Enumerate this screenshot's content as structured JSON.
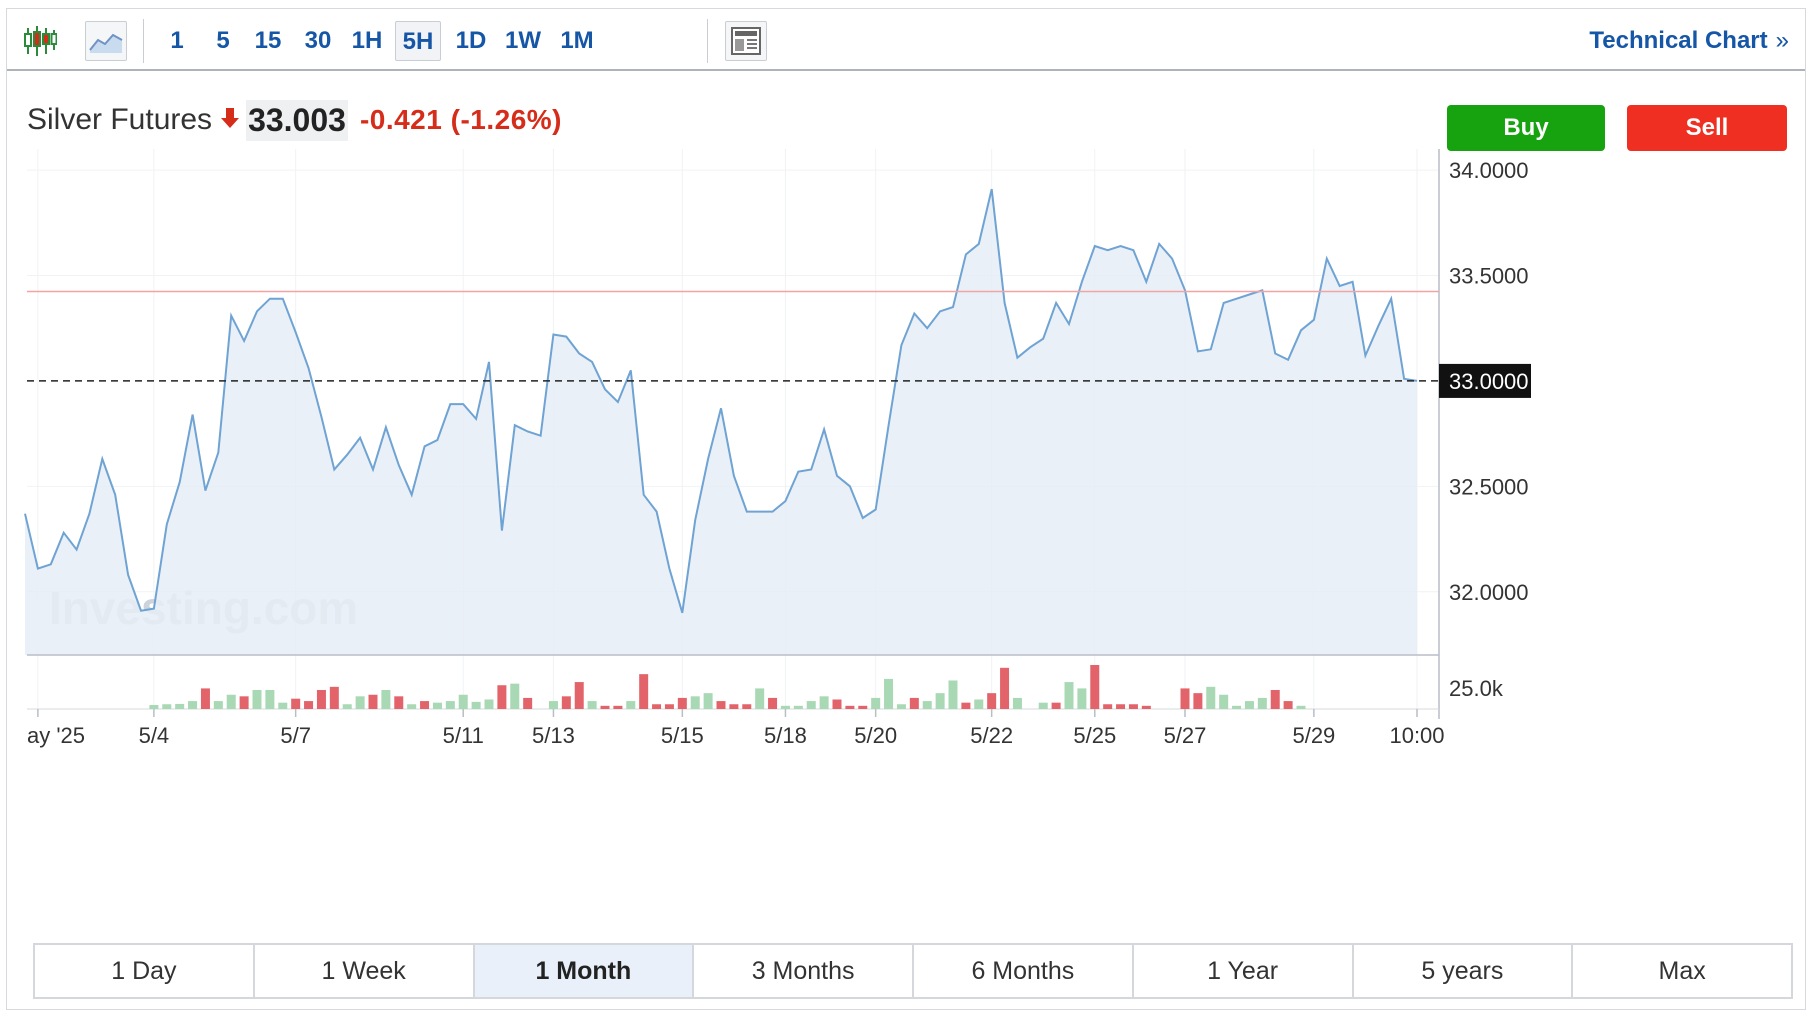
{
  "toolbar": {
    "candles_icon": "candlestick-icon",
    "area_icon": "area-chart-icon",
    "intervals": [
      {
        "label": "1",
        "active": false
      },
      {
        "label": "5",
        "active": false
      },
      {
        "label": "15",
        "active": false
      },
      {
        "label": "30",
        "active": false
      },
      {
        "label": "1H",
        "active": false
      },
      {
        "label": "5H",
        "active": true
      },
      {
        "label": "1D",
        "active": false
      },
      {
        "label": "1W",
        "active": false
      },
      {
        "label": "1M",
        "active": false
      }
    ],
    "layout_icon": "layout-icon",
    "technical_chart_label": "Technical Chart",
    "technical_chart_chevron": "»"
  },
  "quote": {
    "name": "Silver Futures",
    "direction": "down",
    "price": "33.003",
    "change": "-0.421",
    "change_pct": "(-1.26%)"
  },
  "actions": {
    "buy_label": "Buy",
    "sell_label": "Sell"
  },
  "colors": {
    "accent": "#1556a6",
    "buy": "#16a30f",
    "sell": "#ef2f22",
    "line": "#6fa3d3",
    "area": "#e6edf6",
    "prev_close_line": "#f2a3a3",
    "vol_up": "#a8d8b4",
    "vol_down": "#e2646a"
  },
  "chart_data": {
    "type": "area",
    "y_ticks": [
      "34.0000",
      "33.5000",
      "32.5000",
      "32.0000"
    ],
    "ylim": [
      31.7,
      34.1
    ],
    "current_price_label": "33.0000",
    "current_price_value": 33.0,
    "previous_close_value": 33.424,
    "watermark": "Investing.com",
    "x_tick_labels": [
      {
        "label": "ay '25",
        "i": 1
      },
      {
        "label": "5/4",
        "i": 10
      },
      {
        "label": "5/7",
        "i": 21
      },
      {
        "label": "5/11",
        "i": 34
      },
      {
        "label": "5/13",
        "i": 41
      },
      {
        "label": "5/15",
        "i": 51
      },
      {
        "label": "5/18",
        "i": 59
      },
      {
        "label": "5/20",
        "i": 66
      },
      {
        "label": "5/22",
        "i": 75
      },
      {
        "label": "5/25",
        "i": 83
      },
      {
        "label": "5/27",
        "i": 90
      },
      {
        "label": "5/29",
        "i": 100
      },
      {
        "label": "10:00",
        "i": 108
      }
    ],
    "prices": [
      32.37,
      32.11,
      32.13,
      32.28,
      32.2,
      32.37,
      32.63,
      32.46,
      32.08,
      31.91,
      31.92,
      32.32,
      32.52,
      32.84,
      32.48,
      32.66,
      33.31,
      33.19,
      33.33,
      33.39,
      33.39,
      33.23,
      33.06,
      32.83,
      32.58,
      32.65,
      32.73,
      32.58,
      32.78,
      32.6,
      32.46,
      32.69,
      32.72,
      32.89,
      32.89,
      32.82,
      33.09,
      32.29,
      32.79,
      32.76,
      32.74,
      33.22,
      33.21,
      33.13,
      33.09,
      32.96,
      32.9,
      33.05,
      32.46,
      32.38,
      32.11,
      31.9,
      32.34,
      32.63,
      32.87,
      32.55,
      32.38,
      32.38,
      32.38,
      32.43,
      32.57,
      32.58,
      32.77,
      32.55,
      32.5,
      32.35,
      32.39,
      32.79,
      33.17,
      33.32,
      33.25,
      33.33,
      33.35,
      33.6,
      33.65,
      33.91,
      33.37,
      33.11,
      33.16,
      33.2,
      33.37,
      33.27,
      33.47,
      33.64,
      33.62,
      33.64,
      33.62,
      33.47,
      33.65,
      33.58,
      33.43,
      33.14,
      33.15,
      33.37,
      33.39,
      33.41,
      33.43,
      33.13,
      33.1,
      33.24,
      33.29,
      33.58,
      33.45,
      33.47,
      33.12,
      33.26,
      33.39,
      33.01,
      33.0
    ],
    "volume_tick_label": "25.0k",
    "volume_tick_value": 25000,
    "volumes": [
      {
        "i": 10,
        "v": 2500,
        "dir": "up"
      },
      {
        "i": 11,
        "v": 3000,
        "dir": "up"
      },
      {
        "i": 12,
        "v": 3200,
        "dir": "up"
      },
      {
        "i": 13,
        "v": 5000,
        "dir": "up"
      },
      {
        "i": 14,
        "v": 13000,
        "dir": "down"
      },
      {
        "i": 15,
        "v": 5000,
        "dir": "up"
      },
      {
        "i": 16,
        "v": 9000,
        "dir": "up"
      },
      {
        "i": 17,
        "v": 8000,
        "dir": "down"
      },
      {
        "i": 18,
        "v": 12000,
        "dir": "up"
      },
      {
        "i": 19,
        "v": 12000,
        "dir": "up"
      },
      {
        "i": 20,
        "v": 4000,
        "dir": "up"
      },
      {
        "i": 21,
        "v": 6500,
        "dir": "down"
      },
      {
        "i": 22,
        "v": 5000,
        "dir": "down"
      },
      {
        "i": 23,
        "v": 12000,
        "dir": "down"
      },
      {
        "i": 24,
        "v": 14000,
        "dir": "down"
      },
      {
        "i": 25,
        "v": 3000,
        "dir": "up"
      },
      {
        "i": 26,
        "v": 8000,
        "dir": "up"
      },
      {
        "i": 27,
        "v": 9000,
        "dir": "down"
      },
      {
        "i": 28,
        "v": 12000,
        "dir": "up"
      },
      {
        "i": 29,
        "v": 8000,
        "dir": "down"
      },
      {
        "i": 30,
        "v": 3000,
        "dir": "up"
      },
      {
        "i": 31,
        "v": 5000,
        "dir": "down"
      },
      {
        "i": 32,
        "v": 4000,
        "dir": "up"
      },
      {
        "i": 33,
        "v": 5000,
        "dir": "up"
      },
      {
        "i": 34,
        "v": 9000,
        "dir": "up"
      },
      {
        "i": 35,
        "v": 4500,
        "dir": "up"
      },
      {
        "i": 36,
        "v": 6000,
        "dir": "up"
      },
      {
        "i": 37,
        "v": 15000,
        "dir": "down"
      },
      {
        "i": 38,
        "v": 16000,
        "dir": "up"
      },
      {
        "i": 39,
        "v": 7000,
        "dir": "down"
      },
      {
        "i": 41,
        "v": 5000,
        "dir": "up"
      },
      {
        "i": 42,
        "v": 8000,
        "dir": "down"
      },
      {
        "i": 43,
        "v": 17000,
        "dir": "down"
      },
      {
        "i": 44,
        "v": 5000,
        "dir": "up"
      },
      {
        "i": 45,
        "v": 2000,
        "dir": "down"
      },
      {
        "i": 46,
        "v": 2000,
        "dir": "down"
      },
      {
        "i": 47,
        "v": 5000,
        "dir": "up"
      },
      {
        "i": 48,
        "v": 22000,
        "dir": "down"
      },
      {
        "i": 49,
        "v": 3000,
        "dir": "down"
      },
      {
        "i": 50,
        "v": 3000,
        "dir": "down"
      },
      {
        "i": 51,
        "v": 7000,
        "dir": "down"
      },
      {
        "i": 52,
        "v": 8000,
        "dir": "up"
      },
      {
        "i": 53,
        "v": 10000,
        "dir": "up"
      },
      {
        "i": 54,
        "v": 5000,
        "dir": "down"
      },
      {
        "i": 55,
        "v": 3000,
        "dir": "down"
      },
      {
        "i": 56,
        "v": 3000,
        "dir": "down"
      },
      {
        "i": 57,
        "v": 13000,
        "dir": "up"
      },
      {
        "i": 58,
        "v": 7000,
        "dir": "down"
      },
      {
        "i": 59,
        "v": 2000,
        "dir": "up"
      },
      {
        "i": 60,
        "v": 2000,
        "dir": "up"
      },
      {
        "i": 61,
        "v": 5000,
        "dir": "up"
      },
      {
        "i": 62,
        "v": 8000,
        "dir": "up"
      },
      {
        "i": 63,
        "v": 6000,
        "dir": "down"
      },
      {
        "i": 64,
        "v": 2000,
        "dir": "down"
      },
      {
        "i": 65,
        "v": 2000,
        "dir": "down"
      },
      {
        "i": 66,
        "v": 7000,
        "dir": "up"
      },
      {
        "i": 67,
        "v": 19000,
        "dir": "up"
      },
      {
        "i": 68,
        "v": 3000,
        "dir": "up"
      },
      {
        "i": 69,
        "v": 7000,
        "dir": "down"
      },
      {
        "i": 70,
        "v": 5000,
        "dir": "up"
      },
      {
        "i": 71,
        "v": 10000,
        "dir": "up"
      },
      {
        "i": 72,
        "v": 18000,
        "dir": "up"
      },
      {
        "i": 73,
        "v": 4000,
        "dir": "down"
      },
      {
        "i": 74,
        "v": 6000,
        "dir": "up"
      },
      {
        "i": 75,
        "v": 10000,
        "dir": "down"
      },
      {
        "i": 76,
        "v": 26000,
        "dir": "down"
      },
      {
        "i": 77,
        "v": 7000,
        "dir": "up"
      },
      {
        "i": 79,
        "v": 4000,
        "dir": "up"
      },
      {
        "i": 80,
        "v": 4000,
        "dir": "down"
      },
      {
        "i": 81,
        "v": 17000,
        "dir": "up"
      },
      {
        "i": 82,
        "v": 13000,
        "dir": "up"
      },
      {
        "i": 83,
        "v": 34000,
        "dir": "down"
      },
      {
        "i": 84,
        "v": 3000,
        "dir": "down"
      },
      {
        "i": 85,
        "v": 3000,
        "dir": "down"
      },
      {
        "i": 86,
        "v": 3000,
        "dir": "down"
      },
      {
        "i": 87,
        "v": 2000,
        "dir": "down"
      },
      {
        "i": 90,
        "v": 13000,
        "dir": "down"
      },
      {
        "i": 91,
        "v": 10000,
        "dir": "down"
      },
      {
        "i": 92,
        "v": 14000,
        "dir": "up"
      },
      {
        "i": 93,
        "v": 9000,
        "dir": "up"
      },
      {
        "i": 94,
        "v": 2000,
        "dir": "up"
      },
      {
        "i": 95,
        "v": 5000,
        "dir": "up"
      },
      {
        "i": 96,
        "v": 7000,
        "dir": "up"
      },
      {
        "i": 97,
        "v": 12000,
        "dir": "down"
      },
      {
        "i": 98,
        "v": 5000,
        "dir": "down"
      },
      {
        "i": 99,
        "v": 2000,
        "dir": "up"
      }
    ]
  },
  "ranges": [
    {
      "label": "1 Day",
      "active": false
    },
    {
      "label": "1 Week",
      "active": false
    },
    {
      "label": "1 Month",
      "active": true
    },
    {
      "label": "3 Months",
      "active": false
    },
    {
      "label": "6 Months",
      "active": false
    },
    {
      "label": "1 Year",
      "active": false
    },
    {
      "label": "5 years",
      "active": false
    },
    {
      "label": "Max",
      "active": false
    }
  ]
}
